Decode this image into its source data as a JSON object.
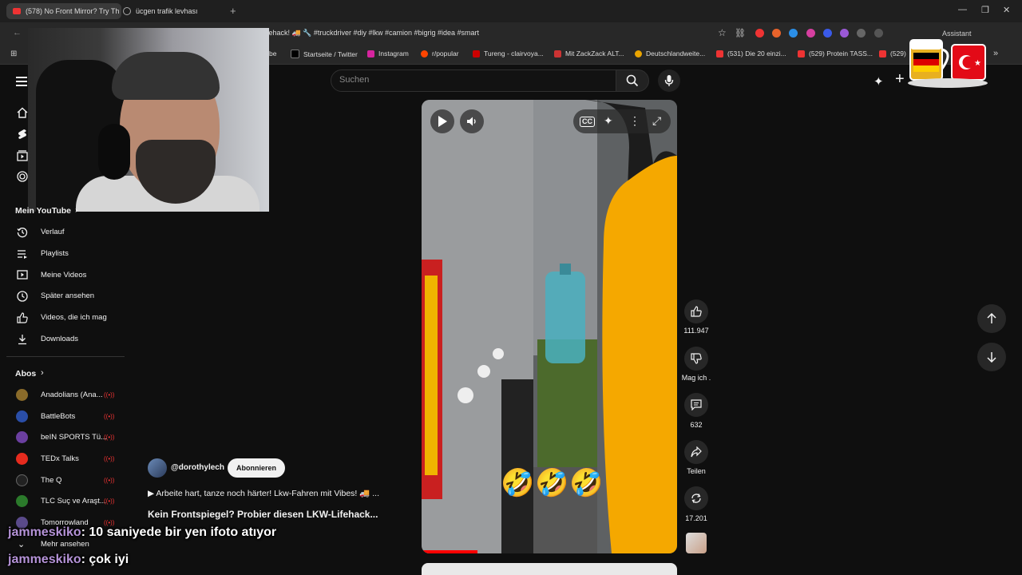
{
  "browser": {
    "tabs": [
      {
        "label": "(578) No Front Mirror? Try Th"
      },
      {
        "label": "ücgen trafik levhası"
      }
    ],
    "new_tab": "+",
    "url": "fehack! 🚚 🔧 #truckdriver #diy #lkw #camion #bigrig #idea #smart",
    "assistant": "Assistant",
    "bookmarks": [
      {
        "label": "be",
        "color": "#e33"
      },
      {
        "label": "Startseite / Twitter",
        "color": "#fff"
      },
      {
        "label": "Instagram",
        "color": "#d6249f"
      },
      {
        "label": "r/popular",
        "color": "#ff4500"
      },
      {
        "label": "Tureng - clairvoya...",
        "color": "#c00"
      },
      {
        "label": "Mit ZackZack ALT...",
        "color": "#c33"
      },
      {
        "label": "Deutschlandweite...",
        "color": "#e9a400"
      },
      {
        "label": "(531) Die 20 einzi...",
        "color": "#e33"
      },
      {
        "label": "(529) Protein TASS...",
        "color": "#e33"
      },
      {
        "label": "(529)",
        "color": "#e33"
      }
    ]
  },
  "header": {
    "search_placeholder": "Suchen"
  },
  "sidebar": {
    "section_my": "Mein YouTube",
    "my_items": [
      {
        "label": "Verlauf"
      },
      {
        "label": "Playlists"
      },
      {
        "label": "Meine Videos"
      },
      {
        "label": "Später ansehen"
      },
      {
        "label": "Videos, die ich mag"
      },
      {
        "label": "Downloads"
      }
    ],
    "section_subs": "Abos",
    "subs": [
      {
        "label": "Anadolians (Ana...",
        "color": "#8a6b2a"
      },
      {
        "label": "BattleBots",
        "color": "#2a4ea8"
      },
      {
        "label": "beIN SPORTS Tü...",
        "color": "#6b3fa0"
      },
      {
        "label": "TEDx Talks",
        "color": "#e62b1e"
      },
      {
        "label": "The Q",
        "color": "#222"
      },
      {
        "label": "TLC Suç ve Araşt...",
        "color": "#2b7a2b"
      },
      {
        "label": "Tomorrowland",
        "color": "#5a4a8a"
      }
    ],
    "more": "Mehr ansehen"
  },
  "video": {
    "emojis": [
      "🤣",
      "🤣",
      "🤣"
    ],
    "progress_fraction": 0.22
  },
  "actions": {
    "likes": "111.947",
    "dislike": "Mag ich .",
    "comments": "632",
    "share": "Teilen",
    "remix": "17.201"
  },
  "info": {
    "channel": "@dorothylech",
    "subscribe": "Abonnieren",
    "description": "▶ Arbeite hart, tanze noch härter! Lkw-Fahren mit Vibes! 🚚 ...",
    "title": "Kein Frontspiegel? Probier diesen LKW-Lifehack..."
  },
  "chat": [
    {
      "user": "jammeskiko",
      "message": ": 10 saniyede bir yen ifoto atıyor"
    },
    {
      "user": "jammeskiko",
      "message": ": çok iyi"
    }
  ],
  "colors": {
    "background": "#0f0f0f",
    "accent_red": "#ff0000",
    "truck_yellow": "#f5a800"
  }
}
